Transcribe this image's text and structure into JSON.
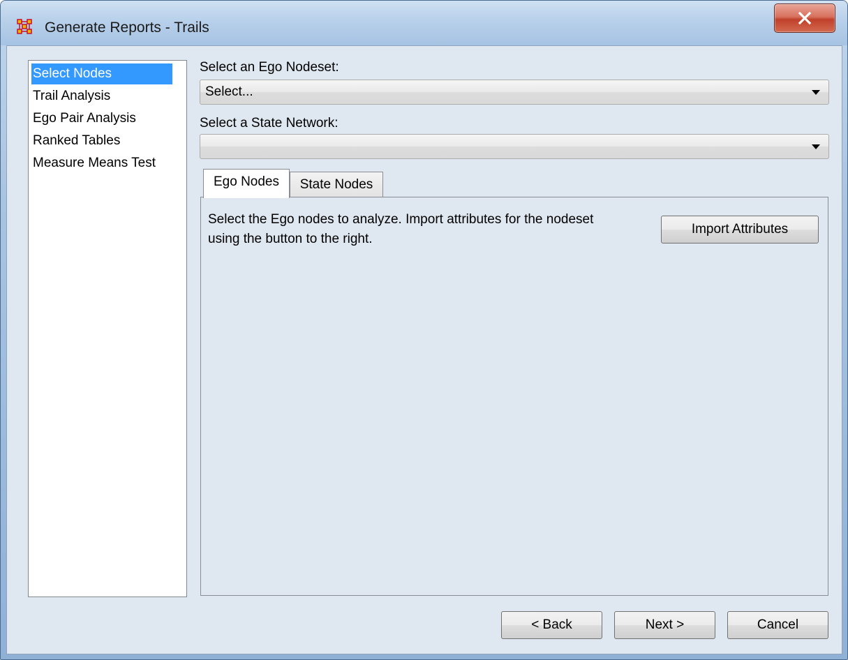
{
  "window": {
    "title": "Generate Reports - Trails"
  },
  "nav": {
    "items": [
      {
        "label": "Select Nodes",
        "selected": true
      },
      {
        "label": "Trail Analysis",
        "selected": false
      },
      {
        "label": "Ego Pair Analysis",
        "selected": false
      },
      {
        "label": "Ranked Tables",
        "selected": false
      },
      {
        "label": "Measure Means Test",
        "selected": false
      }
    ]
  },
  "ego_nodeset": {
    "label": "Select an Ego Nodeset:",
    "value": "Select..."
  },
  "state_network": {
    "label": "Select a State Network:",
    "value": ""
  },
  "tabs": [
    {
      "label": "Ego Nodes",
      "active": true
    },
    {
      "label": "State Nodes",
      "active": false
    }
  ],
  "panel": {
    "description": "Select the Ego nodes to analyze. Import attributes for the nodeset using the button to the right.",
    "import_button": "Import Attributes"
  },
  "footer": {
    "back_label": "< Back",
    "next_label": "Next >",
    "cancel_label": "Cancel"
  },
  "colors": {
    "selection": "#3399ff",
    "client_background": "#dfe7f0",
    "close_button": "#c7432d"
  }
}
